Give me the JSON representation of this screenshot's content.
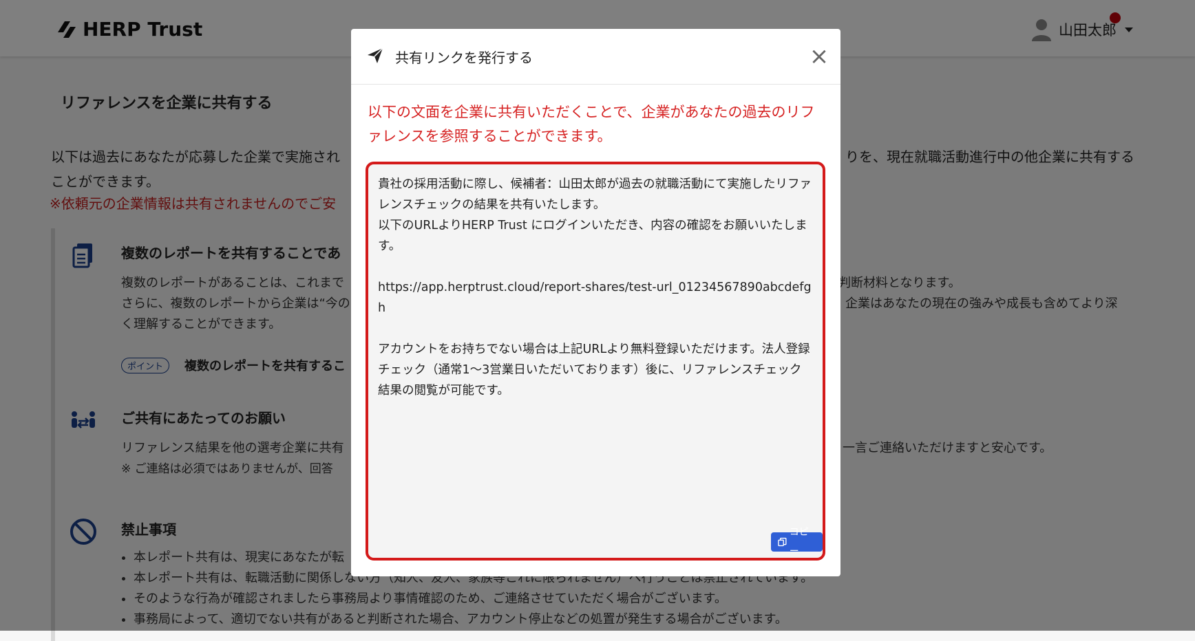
{
  "header": {
    "logo_text": "HERP Trust",
    "user_name": "山田太郎"
  },
  "page": {
    "title": "リファレンスを企業に共有する",
    "intro_line1_left": "以下は過去にあなたが応募した企業で実施され",
    "intro_line1_right": "りを、現在就職活動進行中の他企業に共有する",
    "intro_line2": "ことができます。",
    "intro_note": "※依頼元の企業情報は共有されませんのでご安"
  },
  "sections": {
    "multi": {
      "title": "複数のレポートを共有することであ",
      "line1_left": "複数のレポートがあることは、これまで",
      "line1_right": "判断材料となります。",
      "line2_left": "さらに、複数のレポートから企業は“今の",
      "line2_right": "企業はあなたの現在の強みや成長も含めてより深",
      "line3": "く理解することができます。",
      "badge": "ポイント",
      "badge_text": "複数のレポートを共有するこ"
    },
    "request": {
      "title": "ご共有にあたってのお願い",
      "line1_left": "リファレンス結果を他の選考企業に共有",
      "line1_right": "一言ご連絡いただけますと安心です。",
      "line2": "※ ご連絡は必須ではありませんが、回答"
    },
    "prohibited": {
      "title": "禁止事項",
      "items": [
        "本レポート共有は、現実にあなたが転",
        "本レポート共有は、転職活動に関係しない方（知人、友人、家族等これに限られません）へ行うことは禁止されています。",
        "そのような行為が確認されましたら事務局より事情確認のため、ご連絡させていただく場合がございます。",
        "事務局によって、適切でない共有があると判断された場合、アカウント停止などの処置が発生する場合がございます。"
      ]
    }
  },
  "modal": {
    "title": "共有リンクを発行する",
    "close_label": "×",
    "lead": "以下の文面を企業に共有いただくことで、企業があなたの過去のリファレンスを参照することができます。",
    "message": "貴社の採用活動に際し、候補者：山田太郎が過去の就職活動にて実施したリファレンスチェックの結果を共有いたします。\n以下のURLよりHERP Trust にログインいただき、内容の確認をお願いいたします。\n\nhttps://app.herptrust.cloud/report-shares/test-url_01234567890abcdefgh\n\nアカウントをお持ちでない場合は上記URLより無料登録いただけます。法人登録チェック（通常1〜3営業日いただいております）後に、リファレンスチェック結果の閲覧が可能です。",
    "copy_label": "コピー"
  },
  "colors": {
    "accent_red": "#d41a1a",
    "copy_button": "#2f5fd6",
    "badge_blue": "#1b3f8b"
  },
  "icons": [
    "logo-icon",
    "user-avatar-icon",
    "paper-plane-icon",
    "close-icon",
    "document-icon",
    "people-exchange-icon",
    "prohibited-icon",
    "copy-icon"
  ]
}
